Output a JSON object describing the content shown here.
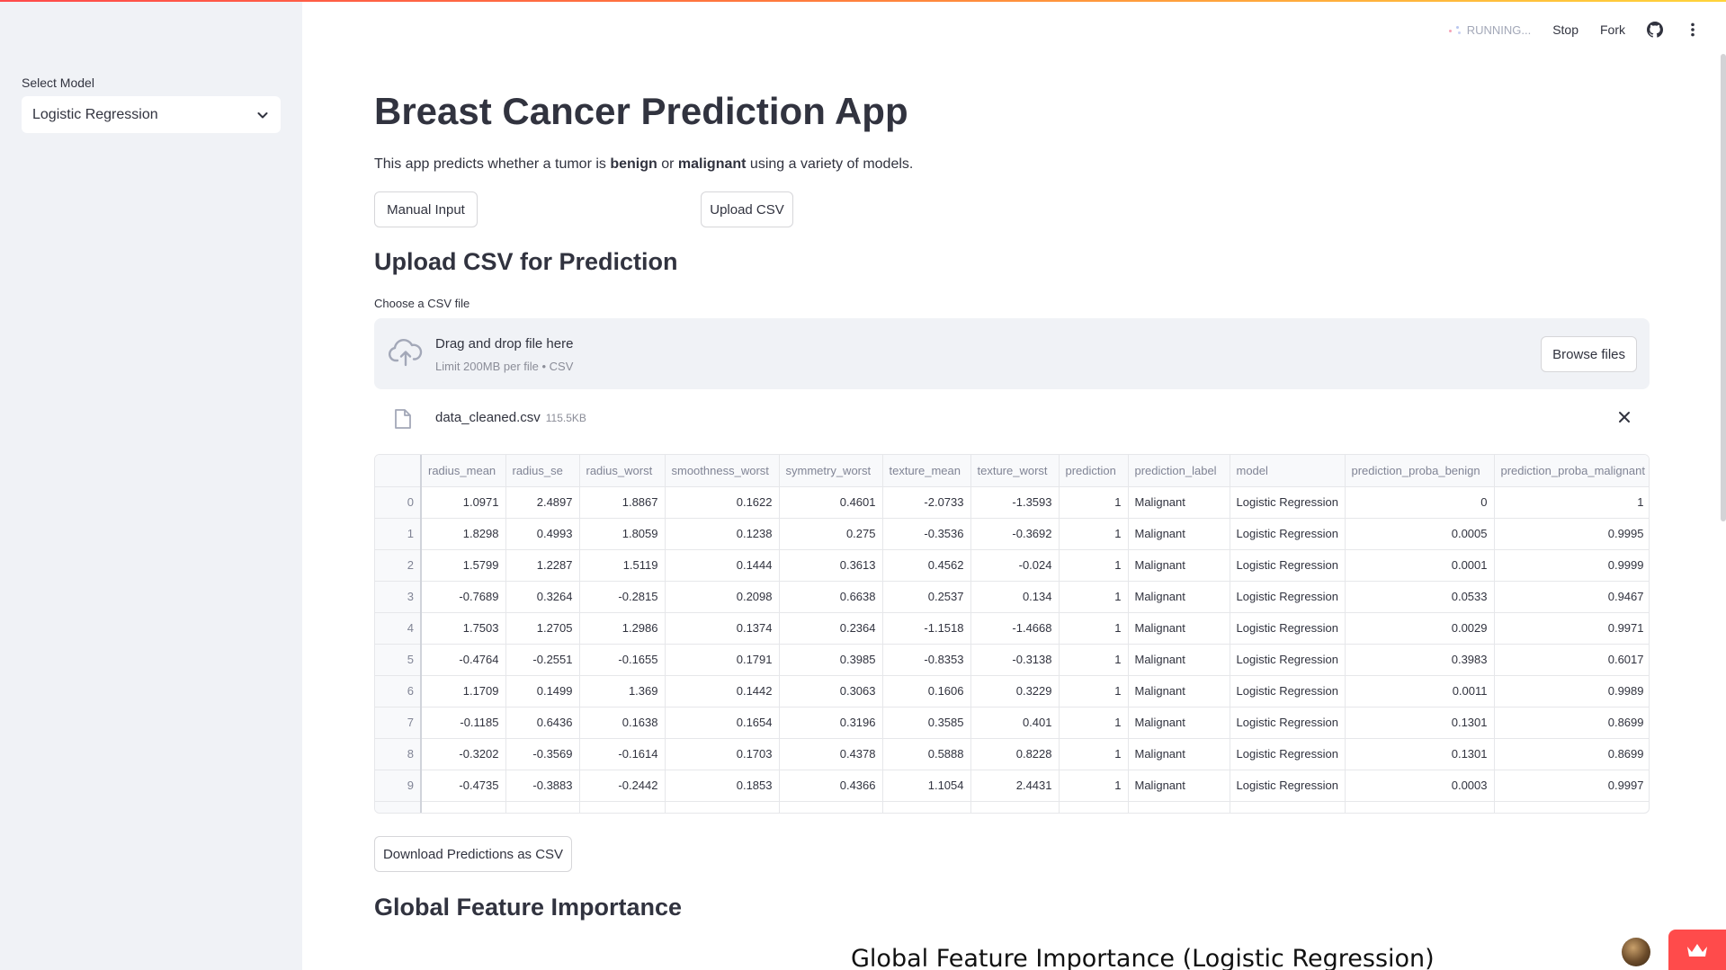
{
  "sidebar": {
    "select_label": "Select Model",
    "select_value": "Logistic Regression"
  },
  "header": {
    "status": "RUNNING...",
    "stop": "Stop",
    "fork": "Fork"
  },
  "main": {
    "title": "Breast Cancer Prediction App",
    "subtitle_parts": [
      "This app predicts whether a tumor is ",
      "benign",
      " or ",
      "malignant",
      " using a variety of models."
    ],
    "buttons": {
      "manual": "Manual Input",
      "upload": "Upload CSV"
    },
    "upload_heading": "Upload CSV for Prediction",
    "file_label": "Choose a CSV file",
    "dropzone": {
      "title": "Drag and drop file here",
      "limit": "Limit 200MB per file • CSV",
      "browse": "Browse files"
    },
    "uploaded_file": {
      "name": "data_cleaned.csv",
      "size": "115.5KB"
    },
    "download_button": "Download Predictions as CSV",
    "feature_heading": "Global Feature Importance",
    "chart_title": "Global Feature Importance (Logistic Regression)"
  },
  "table": {
    "columns": [
      "",
      "radius_mean",
      "radius_se",
      "radius_worst",
      "smoothness_worst",
      "symmetry_worst",
      "texture_mean",
      "texture_worst",
      "prediction",
      "prediction_label",
      "model",
      "prediction_proba_benign",
      "prediction_proba_malignant"
    ],
    "rows": [
      [
        "0",
        "1.0971",
        "2.4897",
        "1.8867",
        "0.1622",
        "0.4601",
        "-2.0733",
        "-1.3593",
        "1",
        "Malignant",
        "Logistic Regression",
        "0",
        "1"
      ],
      [
        "1",
        "1.8298",
        "0.4993",
        "1.8059",
        "0.1238",
        "0.275",
        "-0.3536",
        "-0.3692",
        "1",
        "Malignant",
        "Logistic Regression",
        "0.0005",
        "0.9995"
      ],
      [
        "2",
        "1.5799",
        "1.2287",
        "1.5119",
        "0.1444",
        "0.3613",
        "0.4562",
        "-0.024",
        "1",
        "Malignant",
        "Logistic Regression",
        "0.0001",
        "0.9999"
      ],
      [
        "3",
        "-0.7689",
        "0.3264",
        "-0.2815",
        "0.2098",
        "0.6638",
        "0.2537",
        "0.134",
        "1",
        "Malignant",
        "Logistic Regression",
        "0.0533",
        "0.9467"
      ],
      [
        "4",
        "1.7503",
        "1.2705",
        "1.2986",
        "0.1374",
        "0.2364",
        "-1.1518",
        "-1.4668",
        "1",
        "Malignant",
        "Logistic Regression",
        "0.0029",
        "0.9971"
      ],
      [
        "5",
        "-0.4764",
        "-0.2551",
        "-0.1655",
        "0.1791",
        "0.3985",
        "-0.8353",
        "-0.3138",
        "1",
        "Malignant",
        "Logistic Regression",
        "0.3983",
        "0.6017"
      ],
      [
        "6",
        "1.1709",
        "0.1499",
        "1.369",
        "0.1442",
        "0.3063",
        "0.1606",
        "0.3229",
        "1",
        "Malignant",
        "Logistic Regression",
        "0.0011",
        "0.9989"
      ],
      [
        "7",
        "-0.1185",
        "0.6436",
        "0.1638",
        "0.1654",
        "0.3196",
        "0.3585",
        "0.401",
        "1",
        "Malignant",
        "Logistic Regression",
        "0.1301",
        "0.8699"
      ],
      [
        "8",
        "-0.3202",
        "-0.3569",
        "-0.1614",
        "0.1703",
        "0.4378",
        "0.5888",
        "0.8228",
        "1",
        "Malignant",
        "Logistic Regression",
        "0.1301",
        "0.8699"
      ],
      [
        "9",
        "-0.4735",
        "-0.3883",
        "-0.2442",
        "0.1853",
        "0.4366",
        "1.1054",
        "2.4431",
        "1",
        "Malignant",
        "Logistic Regression",
        "0.0003",
        "0.9997"
      ]
    ]
  },
  "icons": {
    "dropdown": "chevron-down-icon",
    "github": "github-icon",
    "menu": "kebab-menu-icon",
    "upload": "cloud-upload-icon",
    "file": "file-icon",
    "close": "close-icon",
    "crown": "crown-icon"
  },
  "colors": {
    "accent": "#ff4b4b",
    "sidebar_bg": "#f0f2f6",
    "text": "#31333f"
  }
}
